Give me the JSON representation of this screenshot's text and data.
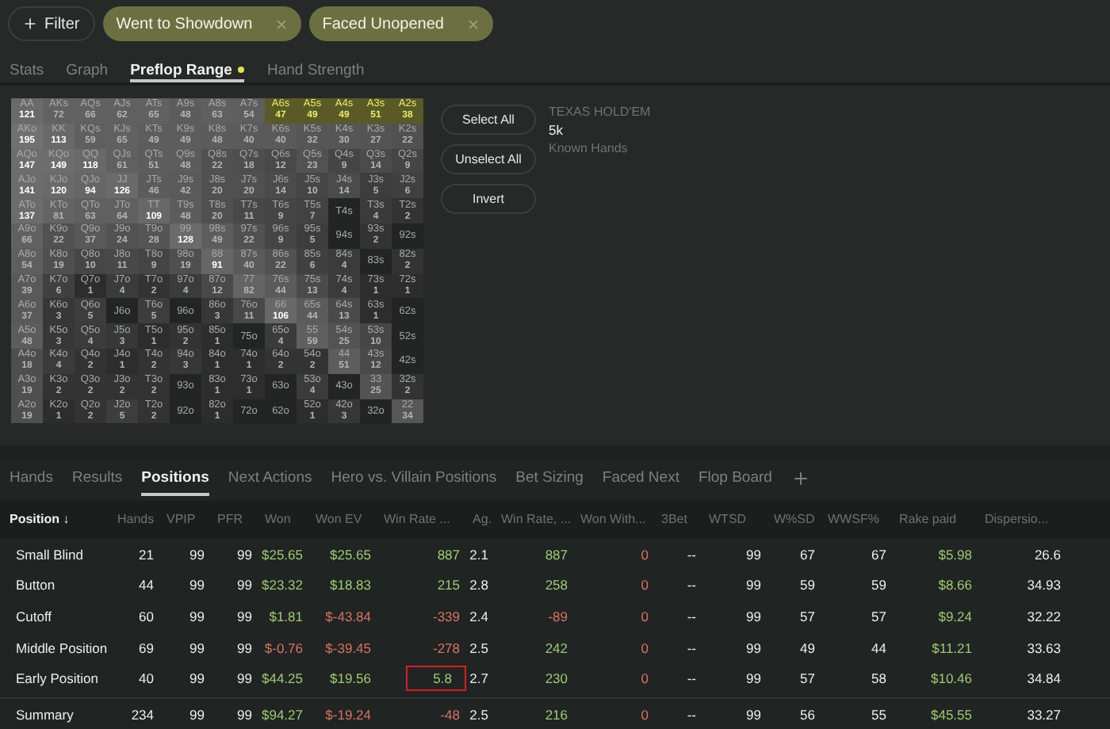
{
  "filter_button": {
    "label": "Filter"
  },
  "filter_chips": [
    {
      "label": "Went to Showdown"
    },
    {
      "label": "Faced Unopened"
    }
  ],
  "view_tabs": [
    {
      "label": "Stats",
      "selected": false,
      "indicator": false
    },
    {
      "label": "Graph",
      "selected": false,
      "indicator": false
    },
    {
      "label": "Preflop Range",
      "selected": true,
      "indicator": true
    },
    {
      "label": "Hand Strength",
      "selected": false,
      "indicator": false
    }
  ],
  "range_grid": {
    "rows": [
      [
        {
          "hand": "AA",
          "count": "121",
          "selected": false
        },
        {
          "hand": "AKs",
          "count": "72",
          "selected": false
        },
        {
          "hand": "AQs",
          "count": "66",
          "selected": false
        },
        {
          "hand": "AJs",
          "count": "62",
          "selected": false
        },
        {
          "hand": "ATs",
          "count": "65",
          "selected": false
        },
        {
          "hand": "A9s",
          "count": "48",
          "selected": false
        },
        {
          "hand": "A8s",
          "count": "63",
          "selected": false
        },
        {
          "hand": "A7s",
          "count": "54",
          "selected": false
        },
        {
          "hand": "A6s",
          "count": "47",
          "selected": true
        },
        {
          "hand": "A5s",
          "count": "49",
          "selected": true
        },
        {
          "hand": "A4s",
          "count": "49",
          "selected": true
        },
        {
          "hand": "A3s",
          "count": "51",
          "selected": true
        },
        {
          "hand": "A2s",
          "count": "38",
          "selected": true
        }
      ],
      [
        {
          "hand": "AKo",
          "count": "195",
          "selected": false
        },
        {
          "hand": "KK",
          "count": "113",
          "selected": false
        },
        {
          "hand": "KQs",
          "count": "59",
          "selected": false
        },
        {
          "hand": "KJs",
          "count": "65",
          "selected": false
        },
        {
          "hand": "KTs",
          "count": "49",
          "selected": false
        },
        {
          "hand": "K9s",
          "count": "49",
          "selected": false
        },
        {
          "hand": "K8s",
          "count": "48",
          "selected": false
        },
        {
          "hand": "K7s",
          "count": "40",
          "selected": false
        },
        {
          "hand": "K6s",
          "count": "40",
          "selected": false
        },
        {
          "hand": "K5s",
          "count": "32",
          "selected": false
        },
        {
          "hand": "K4s",
          "count": "30",
          "selected": false
        },
        {
          "hand": "K3s",
          "count": "27",
          "selected": false
        },
        {
          "hand": "K2s",
          "count": "22",
          "selected": false
        }
      ],
      [
        {
          "hand": "AQo",
          "count": "147",
          "selected": false
        },
        {
          "hand": "KQo",
          "count": "149",
          "selected": false
        },
        {
          "hand": "QQ",
          "count": "118",
          "selected": false
        },
        {
          "hand": "QJs",
          "count": "61",
          "selected": false
        },
        {
          "hand": "QTs",
          "count": "51",
          "selected": false
        },
        {
          "hand": "Q9s",
          "count": "48",
          "selected": false
        },
        {
          "hand": "Q8s",
          "count": "22",
          "selected": false
        },
        {
          "hand": "Q7s",
          "count": "18",
          "selected": false
        },
        {
          "hand": "Q6s",
          "count": "12",
          "selected": false
        },
        {
          "hand": "Q5s",
          "count": "23",
          "selected": false
        },
        {
          "hand": "Q4s",
          "count": "9",
          "selected": false
        },
        {
          "hand": "Q3s",
          "count": "14",
          "selected": false
        },
        {
          "hand": "Q2s",
          "count": "9",
          "selected": false
        }
      ],
      [
        {
          "hand": "AJo",
          "count": "141",
          "selected": false
        },
        {
          "hand": "KJo",
          "count": "120",
          "selected": false
        },
        {
          "hand": "QJo",
          "count": "94",
          "selected": false
        },
        {
          "hand": "JJ",
          "count": "126",
          "selected": false
        },
        {
          "hand": "JTs",
          "count": "46",
          "selected": false
        },
        {
          "hand": "J9s",
          "count": "42",
          "selected": false
        },
        {
          "hand": "J8s",
          "count": "20",
          "selected": false
        },
        {
          "hand": "J7s",
          "count": "20",
          "selected": false
        },
        {
          "hand": "J6s",
          "count": "14",
          "selected": false
        },
        {
          "hand": "J5s",
          "count": "10",
          "selected": false
        },
        {
          "hand": "J4s",
          "count": "14",
          "selected": false
        },
        {
          "hand": "J3s",
          "count": "5",
          "selected": false
        },
        {
          "hand": "J2s",
          "count": "6",
          "selected": false
        }
      ],
      [
        {
          "hand": "ATo",
          "count": "137",
          "selected": false
        },
        {
          "hand": "KTo",
          "count": "81",
          "selected": false
        },
        {
          "hand": "QTo",
          "count": "63",
          "selected": false
        },
        {
          "hand": "JTo",
          "count": "64",
          "selected": false
        },
        {
          "hand": "TT",
          "count": "109",
          "selected": false
        },
        {
          "hand": "T9s",
          "count": "48",
          "selected": false
        },
        {
          "hand": "T8s",
          "count": "20",
          "selected": false
        },
        {
          "hand": "T7s",
          "count": "11",
          "selected": false
        },
        {
          "hand": "T6s",
          "count": "9",
          "selected": false
        },
        {
          "hand": "T5s",
          "count": "7",
          "selected": false
        },
        {
          "hand": "T4s",
          "selected": false
        },
        {
          "hand": "T3s",
          "count": "4",
          "selected": false
        },
        {
          "hand": "T2s",
          "count": "2",
          "selected": false
        }
      ],
      [
        {
          "hand": "A9o",
          "count": "66",
          "selected": false
        },
        {
          "hand": "K9o",
          "count": "22",
          "selected": false
        },
        {
          "hand": "Q9o",
          "count": "37",
          "selected": false
        },
        {
          "hand": "J9o",
          "count": "24",
          "selected": false
        },
        {
          "hand": "T9o",
          "count": "28",
          "selected": false
        },
        {
          "hand": "99",
          "count": "128",
          "selected": false
        },
        {
          "hand": "98s",
          "count": "49",
          "selected": false
        },
        {
          "hand": "97s",
          "count": "22",
          "selected": false
        },
        {
          "hand": "96s",
          "count": "9",
          "selected": false
        },
        {
          "hand": "95s",
          "count": "5",
          "selected": false
        },
        {
          "hand": "94s",
          "selected": false
        },
        {
          "hand": "93s",
          "count": "2",
          "selected": false
        },
        {
          "hand": "92s",
          "selected": false
        }
      ],
      [
        {
          "hand": "A8o",
          "count": "54",
          "selected": false
        },
        {
          "hand": "K8o",
          "count": "19",
          "selected": false
        },
        {
          "hand": "Q8o",
          "count": "10",
          "selected": false
        },
        {
          "hand": "J8o",
          "count": "11",
          "selected": false
        },
        {
          "hand": "T8o",
          "count": "9",
          "selected": false
        },
        {
          "hand": "98o",
          "count": "19",
          "selected": false
        },
        {
          "hand": "88",
          "count": "91",
          "selected": false
        },
        {
          "hand": "87s",
          "count": "40",
          "selected": false
        },
        {
          "hand": "86s",
          "count": "22",
          "selected": false
        },
        {
          "hand": "85s",
          "count": "6",
          "selected": false
        },
        {
          "hand": "84s",
          "count": "4",
          "selected": false
        },
        {
          "hand": "83s",
          "selected": false
        },
        {
          "hand": "82s",
          "count": "2",
          "selected": false
        }
      ],
      [
        {
          "hand": "A7o",
          "count": "39",
          "selected": false
        },
        {
          "hand": "K7o",
          "count": "6",
          "selected": false
        },
        {
          "hand": "Q7o",
          "count": "1",
          "selected": false
        },
        {
          "hand": "J7o",
          "count": "4",
          "selected": false
        },
        {
          "hand": "T7o",
          "count": "2",
          "selected": false
        },
        {
          "hand": "97o",
          "count": "4",
          "selected": false
        },
        {
          "hand": "87o",
          "count": "12",
          "selected": false
        },
        {
          "hand": "77",
          "count": "82",
          "selected": false
        },
        {
          "hand": "76s",
          "count": "44",
          "selected": false
        },
        {
          "hand": "75s",
          "count": "13",
          "selected": false
        },
        {
          "hand": "74s",
          "count": "4",
          "selected": false
        },
        {
          "hand": "73s",
          "count": "1",
          "selected": false
        },
        {
          "hand": "72s",
          "count": "1",
          "selected": false
        }
      ],
      [
        {
          "hand": "A6o",
          "count": "37",
          "selected": false
        },
        {
          "hand": "K6o",
          "count": "3",
          "selected": false
        },
        {
          "hand": "Q6o",
          "count": "5",
          "selected": false
        },
        {
          "hand": "J6o",
          "selected": false
        },
        {
          "hand": "T6o",
          "count": "5",
          "selected": false
        },
        {
          "hand": "96o",
          "selected": false
        },
        {
          "hand": "86o",
          "count": "3",
          "selected": false
        },
        {
          "hand": "76o",
          "count": "11",
          "selected": false
        },
        {
          "hand": "66",
          "count": "106",
          "selected": false
        },
        {
          "hand": "65s",
          "count": "44",
          "selected": false
        },
        {
          "hand": "64s",
          "count": "13",
          "selected": false
        },
        {
          "hand": "63s",
          "count": "1",
          "selected": false
        },
        {
          "hand": "62s",
          "selected": false
        }
      ],
      [
        {
          "hand": "A5o",
          "count": "48",
          "selected": false
        },
        {
          "hand": "K5o",
          "count": "3",
          "selected": false
        },
        {
          "hand": "Q5o",
          "count": "4",
          "selected": false
        },
        {
          "hand": "J5o",
          "count": "3",
          "selected": false
        },
        {
          "hand": "T5o",
          "count": "1",
          "selected": false
        },
        {
          "hand": "95o",
          "count": "2",
          "selected": false
        },
        {
          "hand": "85o",
          "count": "1",
          "selected": false
        },
        {
          "hand": "75o",
          "selected": false
        },
        {
          "hand": "65o",
          "count": "4",
          "selected": false
        },
        {
          "hand": "55",
          "count": "59",
          "selected": false
        },
        {
          "hand": "54s",
          "count": "25",
          "selected": false
        },
        {
          "hand": "53s",
          "count": "10",
          "selected": false
        },
        {
          "hand": "52s",
          "selected": false
        }
      ],
      [
        {
          "hand": "A4o",
          "count": "18",
          "selected": false
        },
        {
          "hand": "K4o",
          "count": "4",
          "selected": false
        },
        {
          "hand": "Q4o",
          "count": "2",
          "selected": false
        },
        {
          "hand": "J4o",
          "count": "1",
          "selected": false
        },
        {
          "hand": "T4o",
          "count": "2",
          "selected": false
        },
        {
          "hand": "94o",
          "count": "3",
          "selected": false
        },
        {
          "hand": "84o",
          "count": "1",
          "selected": false
        },
        {
          "hand": "74o",
          "count": "1",
          "selected": false
        },
        {
          "hand": "64o",
          "count": "2",
          "selected": false
        },
        {
          "hand": "54o",
          "count": "2",
          "selected": false
        },
        {
          "hand": "44",
          "count": "51",
          "selected": false
        },
        {
          "hand": "43s",
          "count": "12",
          "selected": false
        },
        {
          "hand": "42s",
          "selected": false
        }
      ],
      [
        {
          "hand": "A3o",
          "count": "19",
          "selected": false
        },
        {
          "hand": "K3o",
          "count": "2",
          "selected": false
        },
        {
          "hand": "Q3o",
          "count": "2",
          "selected": false
        },
        {
          "hand": "J3o",
          "count": "2",
          "selected": false
        },
        {
          "hand": "T3o",
          "count": "2",
          "selected": false
        },
        {
          "hand": "93o",
          "selected": false
        },
        {
          "hand": "83o",
          "count": "1",
          "selected": false
        },
        {
          "hand": "73o",
          "count": "1",
          "selected": false
        },
        {
          "hand": "63o",
          "selected": false
        },
        {
          "hand": "53o",
          "count": "4",
          "selected": false
        },
        {
          "hand": "43o",
          "selected": false
        },
        {
          "hand": "33",
          "count": "25",
          "selected": false
        },
        {
          "hand": "32s",
          "count": "2",
          "selected": false
        }
      ],
      [
        {
          "hand": "A2o",
          "count": "19",
          "selected": false
        },
        {
          "hand": "K2o",
          "count": "1",
          "selected": false
        },
        {
          "hand": "Q2o",
          "count": "2",
          "selected": false
        },
        {
          "hand": "J2o",
          "count": "5",
          "selected": false
        },
        {
          "hand": "T2o",
          "count": "2",
          "selected": false
        },
        {
          "hand": "92o",
          "selected": false
        },
        {
          "hand": "82o",
          "count": "1",
          "selected": false
        },
        {
          "hand": "72o",
          "selected": false
        },
        {
          "hand": "62o",
          "selected": false
        },
        {
          "hand": "52o",
          "count": "1",
          "selected": false
        },
        {
          "hand": "42o",
          "count": "3",
          "selected": false
        },
        {
          "hand": "32o",
          "selected": false
        },
        {
          "hand": "22",
          "count": "34",
          "selected": false
        }
      ]
    ]
  },
  "range_buttons": [
    "Select All",
    "Unselect All",
    "Invert"
  ],
  "game_info": {
    "game": "TEXAS HOLD'EM",
    "hands": "5k",
    "hands_label": "Known Hands"
  },
  "report_tabs": [
    {
      "label": "Hands",
      "selected": false
    },
    {
      "label": "Results",
      "selected": false
    },
    {
      "label": "Positions",
      "selected": true
    },
    {
      "label": "Next Actions",
      "selected": false
    },
    {
      "label": "Hero vs. Villain Positions",
      "selected": false
    },
    {
      "label": "Bet Sizing",
      "selected": false
    },
    {
      "label": "Faced Next",
      "selected": false
    },
    {
      "label": "Flop Board",
      "selected": false
    }
  ],
  "table": {
    "columns": [
      "Position ↓",
      "Hands",
      "VPIP",
      "PFR",
      "Won",
      "Won EV",
      "Win Rate ...",
      "Ag.",
      "Win Rate, ...",
      "Won With...",
      "3Bet",
      "WTSD",
      "W%SD",
      "WWSF%",
      "Rake paid",
      "Dispersio..."
    ],
    "rows": [
      {
        "kind": "position",
        "cells": [
          {
            "text": "Small Blind",
            "kind": "plain",
            "outlined": false
          },
          {
            "text": "21",
            "kind": "plain",
            "outlined": false
          },
          {
            "text": "99",
            "kind": "plain",
            "outlined": false
          },
          {
            "text": "99",
            "kind": "plain",
            "outlined": false
          },
          {
            "text": "$25.65",
            "kind": "gain",
            "outlined": false
          },
          {
            "text": "$25.65",
            "kind": "gain",
            "outlined": false
          },
          {
            "text": "887",
            "kind": "gain",
            "outlined": false
          },
          {
            "text": "2.1",
            "kind": "plain",
            "outlined": false
          },
          {
            "text": "887",
            "kind": "gain",
            "outlined": false
          },
          {
            "text": "0",
            "kind": "loss",
            "outlined": false
          },
          {
            "text": "--",
            "kind": "plain",
            "outlined": false
          },
          {
            "text": "99",
            "kind": "plain",
            "outlined": false
          },
          {
            "text": "67",
            "kind": "plain",
            "outlined": false
          },
          {
            "text": "67",
            "kind": "plain",
            "outlined": false
          },
          {
            "text": "$5.98",
            "kind": "gain",
            "outlined": false
          },
          {
            "text": "26.6",
            "kind": "plain",
            "outlined": false
          }
        ]
      },
      {
        "kind": "position",
        "cells": [
          {
            "text": "Button",
            "kind": "plain",
            "outlined": false
          },
          {
            "text": "44",
            "kind": "plain",
            "outlined": false
          },
          {
            "text": "99",
            "kind": "plain",
            "outlined": false
          },
          {
            "text": "99",
            "kind": "plain",
            "outlined": false
          },
          {
            "text": "$23.32",
            "kind": "gain",
            "outlined": false
          },
          {
            "text": "$18.83",
            "kind": "gain",
            "outlined": false
          },
          {
            "text": "215",
            "kind": "gain",
            "outlined": false
          },
          {
            "text": "2.8",
            "kind": "plain",
            "outlined": false
          },
          {
            "text": "258",
            "kind": "gain",
            "outlined": false
          },
          {
            "text": "0",
            "kind": "loss",
            "outlined": false
          },
          {
            "text": "--",
            "kind": "plain",
            "outlined": false
          },
          {
            "text": "99",
            "kind": "plain",
            "outlined": false
          },
          {
            "text": "59",
            "kind": "plain",
            "outlined": false
          },
          {
            "text": "59",
            "kind": "plain",
            "outlined": false
          },
          {
            "text": "$8.66",
            "kind": "gain",
            "outlined": false
          },
          {
            "text": "34.93",
            "kind": "plain",
            "outlined": false
          }
        ]
      },
      {
        "kind": "position",
        "cells": [
          {
            "text": "Cutoff",
            "kind": "plain",
            "outlined": false
          },
          {
            "text": "60",
            "kind": "plain",
            "outlined": false
          },
          {
            "text": "99",
            "kind": "plain",
            "outlined": false
          },
          {
            "text": "99",
            "kind": "plain",
            "outlined": false
          },
          {
            "text": "$1.81",
            "kind": "gain",
            "outlined": false
          },
          {
            "text": "$-43.84",
            "kind": "loss",
            "outlined": false
          },
          {
            "text": "-339",
            "kind": "loss",
            "outlined": false
          },
          {
            "text": "2.4",
            "kind": "plain",
            "outlined": false
          },
          {
            "text": "-89",
            "kind": "loss",
            "outlined": false
          },
          {
            "text": "0",
            "kind": "loss",
            "outlined": false
          },
          {
            "text": "--",
            "kind": "plain",
            "outlined": false
          },
          {
            "text": "99",
            "kind": "plain",
            "outlined": false
          },
          {
            "text": "57",
            "kind": "plain",
            "outlined": false
          },
          {
            "text": "57",
            "kind": "plain",
            "outlined": false
          },
          {
            "text": "$9.24",
            "kind": "gain",
            "outlined": false
          },
          {
            "text": "32.22",
            "kind": "plain",
            "outlined": false
          }
        ]
      },
      {
        "kind": "position",
        "cells": [
          {
            "text": "Middle Position",
            "kind": "plain",
            "outlined": false
          },
          {
            "text": "69",
            "kind": "plain",
            "outlined": false
          },
          {
            "text": "99",
            "kind": "plain",
            "outlined": false
          },
          {
            "text": "99",
            "kind": "plain",
            "outlined": false
          },
          {
            "text": "$-0.76",
            "kind": "loss",
            "outlined": false
          },
          {
            "text": "$-39.45",
            "kind": "loss",
            "outlined": false
          },
          {
            "text": "-278",
            "kind": "loss",
            "outlined": false
          },
          {
            "text": "2.5",
            "kind": "plain",
            "outlined": false
          },
          {
            "text": "242",
            "kind": "gain",
            "outlined": false
          },
          {
            "text": "0",
            "kind": "loss",
            "outlined": false
          },
          {
            "text": "--",
            "kind": "plain",
            "outlined": false
          },
          {
            "text": "99",
            "kind": "plain",
            "outlined": false
          },
          {
            "text": "49",
            "kind": "plain",
            "outlined": false
          },
          {
            "text": "44",
            "kind": "plain",
            "outlined": false
          },
          {
            "text": "$11.21",
            "kind": "gain",
            "outlined": false
          },
          {
            "text": "33.63",
            "kind": "plain",
            "outlined": false
          }
        ]
      },
      {
        "kind": "position",
        "cells": [
          {
            "text": "Early Position",
            "kind": "plain",
            "outlined": false
          },
          {
            "text": "40",
            "kind": "plain",
            "outlined": false
          },
          {
            "text": "99",
            "kind": "plain",
            "outlined": false
          },
          {
            "text": "99",
            "kind": "plain",
            "outlined": false
          },
          {
            "text": "$44.25",
            "kind": "gain",
            "outlined": false
          },
          {
            "text": "$19.56",
            "kind": "gain",
            "outlined": false
          },
          {
            "text": "5.8",
            "kind": "gain",
            "outlined": true
          },
          {
            "text": "2.7",
            "kind": "plain",
            "outlined": false
          },
          {
            "text": "230",
            "kind": "gain",
            "outlined": false
          },
          {
            "text": "0",
            "kind": "loss",
            "outlined": false
          },
          {
            "text": "--",
            "kind": "plain",
            "outlined": false
          },
          {
            "text": "99",
            "kind": "plain",
            "outlined": false
          },
          {
            "text": "57",
            "kind": "plain",
            "outlined": false
          },
          {
            "text": "58",
            "kind": "plain",
            "outlined": false
          },
          {
            "text": "$10.46",
            "kind": "gain",
            "outlined": false
          },
          {
            "text": "34.84",
            "kind": "plain",
            "outlined": false
          }
        ]
      },
      {
        "kind": "summary",
        "cells": [
          {
            "text": "Summary",
            "kind": "plain",
            "outlined": false
          },
          {
            "text": "234",
            "kind": "plain",
            "outlined": false
          },
          {
            "text": "99",
            "kind": "plain",
            "outlined": false
          },
          {
            "text": "99",
            "kind": "plain",
            "outlined": false
          },
          {
            "text": "$94.27",
            "kind": "gain",
            "outlined": false
          },
          {
            "text": "$-19.24",
            "kind": "loss",
            "outlined": false
          },
          {
            "text": "-48",
            "kind": "loss",
            "outlined": false
          },
          {
            "text": "2.5",
            "kind": "plain",
            "outlined": false
          },
          {
            "text": "216",
            "kind": "gain",
            "outlined": false
          },
          {
            "text": "0",
            "kind": "loss",
            "outlined": false
          },
          {
            "text": "--",
            "kind": "plain",
            "outlined": false
          },
          {
            "text": "99",
            "kind": "plain",
            "outlined": false
          },
          {
            "text": "56",
            "kind": "plain",
            "outlined": false
          },
          {
            "text": "55",
            "kind": "plain",
            "outlined": false
          },
          {
            "text": "$45.55",
            "kind": "gain",
            "outlined": false
          },
          {
            "text": "33.27",
            "kind": "plain",
            "outlined": false
          }
        ]
      }
    ]
  }
}
